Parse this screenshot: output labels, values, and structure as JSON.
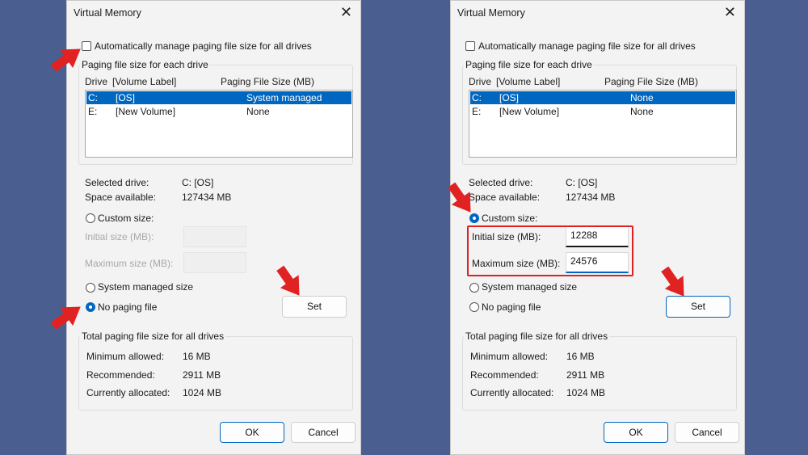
{
  "colors": {
    "background": "#4a5f8f",
    "dialog": "#f3f3f3",
    "accent": "#0067c0",
    "annotation": "#e02222"
  },
  "left": {
    "title": "Virtual Memory",
    "close_icon": "✕",
    "auto_manage_label": "Automatically manage paging file size for all drives",
    "auto_manage_checked": false,
    "paging_group_label": "Paging file size for each drive",
    "col_drive": "Drive",
    "col_label": "[Volume Label]",
    "col_size": "Paging File Size (MB)",
    "drives": [
      {
        "drive": "C:",
        "label": "[OS]",
        "size": "System managed"
      },
      {
        "drive": "E:",
        "label": "[New Volume]",
        "size": "None"
      }
    ],
    "selected_drive_label": "Selected drive:",
    "selected_drive_value": "C:  [OS]",
    "space_label": "Space available:",
    "space_value": "127434 MB",
    "custom_size_label": "Custom size:",
    "initial_label": "Initial size (MB):",
    "initial_value": "",
    "max_label": "Maximum size (MB):",
    "max_value": "",
    "system_managed_label": "System managed size",
    "no_paging_label": "No paging file",
    "selected_option": "no_paging",
    "set_label": "Set",
    "total_group_label": "Total paging file size for all drives",
    "min_label": "Minimum allowed:",
    "min_value": "16 MB",
    "rec_label": "Recommended:",
    "rec_value": "2911 MB",
    "cur_label": "Currently allocated:",
    "cur_value": "1024 MB",
    "ok_label": "OK",
    "cancel_label": "Cancel"
  },
  "right": {
    "title": "Virtual Memory",
    "close_icon": "✕",
    "auto_manage_label": "Automatically manage paging file size for all drives",
    "auto_manage_checked": false,
    "paging_group_label": "Paging file size for each drive",
    "col_drive": "Drive",
    "col_label": "[Volume Label]",
    "col_size": "Paging File Size (MB)",
    "drives": [
      {
        "drive": "C:",
        "label": "[OS]",
        "size": "None"
      },
      {
        "drive": "E:",
        "label": "[New Volume]",
        "size": "None"
      }
    ],
    "selected_drive_label": "Selected drive:",
    "selected_drive_value": "C:  [OS]",
    "space_label": "Space available:",
    "space_value": "127434 MB",
    "custom_size_label": "Custom size:",
    "initial_label": "Initial size (MB):",
    "initial_value": "12288",
    "max_label": "Maximum size (MB):",
    "max_value": "24576",
    "system_managed_label": "System managed size",
    "no_paging_label": "No paging file",
    "selected_option": "custom",
    "set_label": "Set",
    "total_group_label": "Total paging file size for all drives",
    "min_label": "Minimum allowed:",
    "min_value": "16 MB",
    "rec_label": "Recommended:",
    "rec_value": "2911 MB",
    "cur_label": "Currently allocated:",
    "cur_value": "1024 MB",
    "ok_label": "OK",
    "cancel_label": "Cancel"
  }
}
